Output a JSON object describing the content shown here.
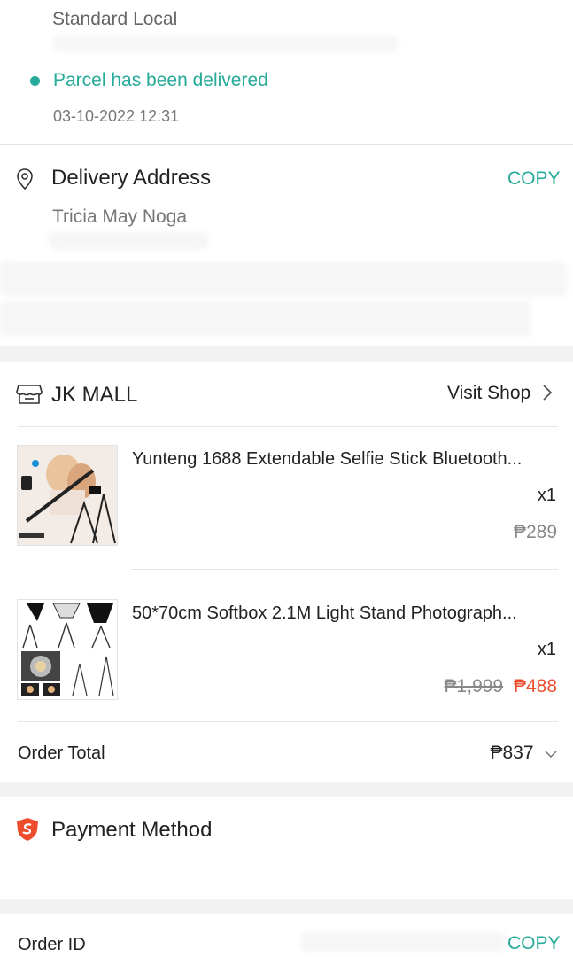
{
  "shipping": {
    "method": "Standard Local",
    "status": "Parcel has been delivered",
    "timestamp": "03-10-2022 12:31"
  },
  "address": {
    "title": "Delivery Address",
    "copy_label": "COPY",
    "name": "Tricia May Noga"
  },
  "shop": {
    "name": "JK MALL",
    "visit_label": "Visit Shop"
  },
  "products": [
    {
      "title": "Yunteng 1688 Extendable Selfie Stick Bluetooth...",
      "qty": "x1",
      "price": "₱289"
    },
    {
      "title": "50*70cm Softbox 2.1M Light Stand Photograph...",
      "qty": "x1",
      "original_price": "₱1,999",
      "price": "₱488"
    }
  ],
  "order_total": {
    "label": "Order Total",
    "value": "₱837"
  },
  "payment": {
    "title": "Payment Method"
  },
  "order_id": {
    "label": "Order ID",
    "copy_label": "COPY"
  },
  "colors": {
    "accent": "#26aa99",
    "price_highlight": "#ee4d2d"
  }
}
